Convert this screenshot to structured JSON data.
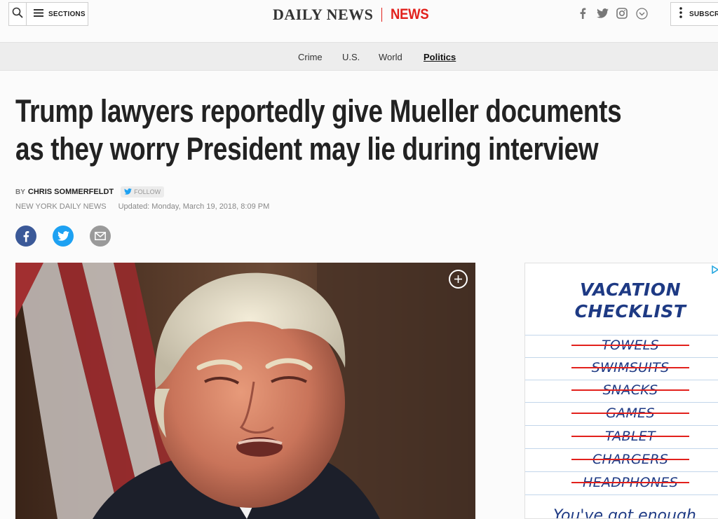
{
  "header": {
    "sections_label": "SECTIONS",
    "logo_text": "DAILY NEWS",
    "section_name": "NEWS",
    "subscribe_label": "SUBSCRIBE",
    "social_icons": [
      "facebook-icon",
      "twitter-icon",
      "instagram-icon",
      "chevron-down-icon"
    ]
  },
  "nav": {
    "items": [
      "Crime",
      "U.S.",
      "World",
      "Politics"
    ],
    "active": "Politics"
  },
  "article": {
    "headline_line1": "Trump lawyers reportedly give Mueller documents",
    "headline_line2": "as they worry President may lie during interview",
    "by": "BY",
    "author": "CHRIS SOMMERFELDT",
    "follow_label": "FOLLOW",
    "source": "NEW YORK DAILY NEWS",
    "updated": "Updated: Monday, March 19, 2018, 8:09 PM"
  },
  "ad": {
    "title_line1": "VACATION",
    "title_line2": "CHECKLIST",
    "items": [
      "TOWELS",
      "SWIMSUITS",
      "SNACKS",
      "GAMES",
      "TABLET",
      "CHARGERS",
      "HEADPHONES"
    ],
    "tagline": "You've got enough"
  },
  "colors": {
    "brand_red": "#e2211c",
    "facebook": "#3b5998",
    "twitter": "#1da1f2",
    "email": "#9a9a9a",
    "ad_blue": "#1e3a84"
  }
}
